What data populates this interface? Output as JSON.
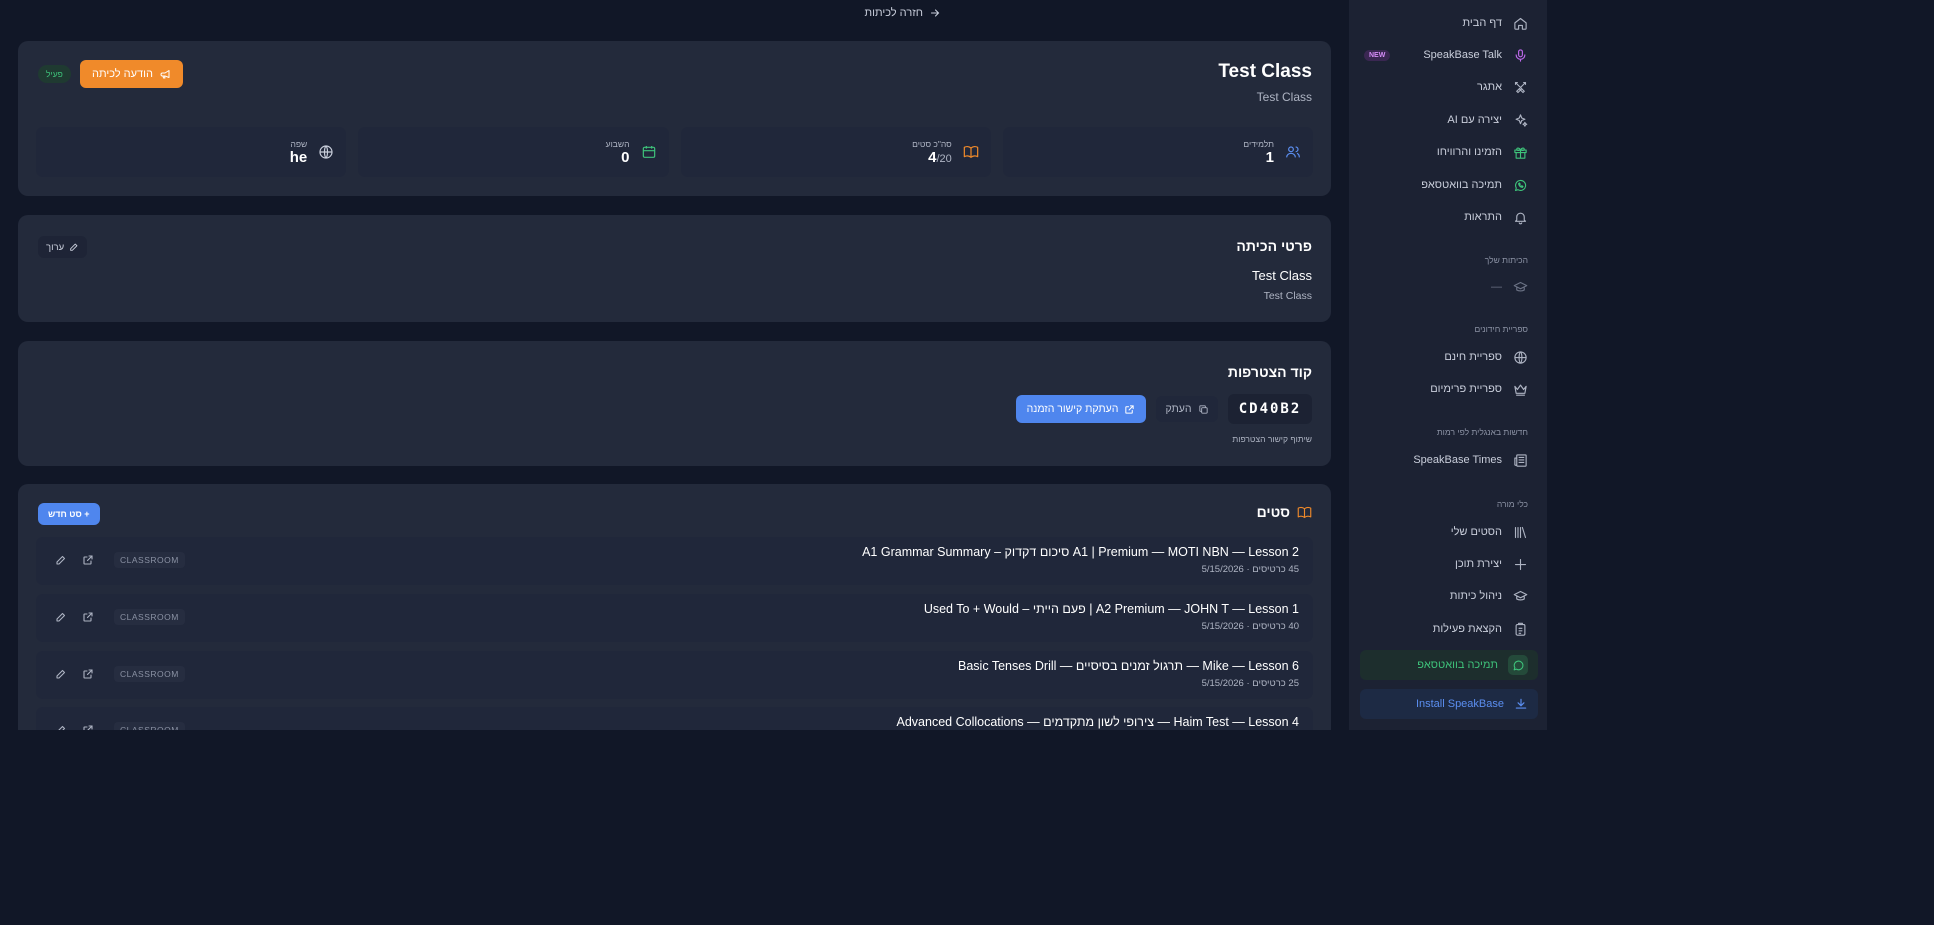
{
  "back_link": "חזרה לכיתות",
  "sidebar": {
    "items": [
      {
        "label": "דף הבית",
        "icon": "home-icon"
      },
      {
        "label": "SpeakBase Talk",
        "icon": "microphone-icon",
        "badge": "NEW"
      },
      {
        "label": "אתגר",
        "icon": "swords-icon"
      },
      {
        "label": "יצירה עם AI",
        "icon": "sparkles-icon"
      },
      {
        "label": "הזמינו והרוויחו",
        "icon": "gift-icon"
      },
      {
        "label": "תמיכה בוואטסאפ",
        "icon": "whatsapp-icon"
      },
      {
        "label": "התראות",
        "icon": "bell-icon"
      }
    ],
    "classes_section": "הכיתות שלך",
    "classes_placeholder": "—",
    "library_section": "ספריית חידונים",
    "library_items": [
      {
        "label": "ספריית חינם",
        "icon": "globe-icon"
      },
      {
        "label": "ספריית פרימיום",
        "icon": "crown-icon"
      }
    ],
    "news_section": "חדשות באנגלית לפי רמות",
    "news_items": [
      {
        "label": "SpeakBase Times",
        "icon": "newspaper-icon"
      }
    ],
    "teacher_section": "כלי מורה",
    "teacher_items": [
      {
        "label": "הסטים שלי",
        "icon": "library-icon"
      },
      {
        "label": "יצירת תוכן",
        "icon": "plus-icon"
      },
      {
        "label": "ניהול כיתות",
        "icon": "graduation-cap-icon"
      },
      {
        "label": "הקצאת פעילות",
        "icon": "clipboard-icon"
      }
    ],
    "whatsapp_active": "תמיכה בוואטסאפ",
    "install": "Install SpeakBase"
  },
  "class_header": {
    "title": "Test Class",
    "subtitle": "Test Class",
    "status": "פעיל",
    "announce_button": "הודעה לכיתה",
    "stats": [
      {
        "label": "תלמידים",
        "value": "1",
        "suffix": "",
        "icon": "users-icon",
        "color": "#5b8ef0"
      },
      {
        "label": "סה\"כ סטים",
        "value": "4",
        "suffix": "/20",
        "icon": "book-icon",
        "color": "#f08a2a"
      },
      {
        "label": "השבוע",
        "value": "0",
        "suffix": "",
        "icon": "calendar-icon",
        "color": "#3ec27a"
      },
      {
        "label": "שפה",
        "value": "he",
        "suffix": "",
        "icon": "globe-icon",
        "color": "#c9cedb"
      }
    ]
  },
  "details": {
    "title": "פרטי הכיתה",
    "name": "Test Class",
    "description": "Test Class",
    "edit_button": "ערוך"
  },
  "join": {
    "title": "קוד הצטרפות",
    "code": "CD40B2",
    "copy_button": "העתק",
    "invite_button": "העתקת קישור הזמנה",
    "caption": "שיתוף קישור הצטרפות"
  },
  "sets": {
    "title": "סטים",
    "new_button": "+ סט חדש",
    "rows": [
      {
        "title": "A1 | Premium — MOTI NBN — Lesson 2 סיכום דקדוק – A1 Grammar Summary",
        "meta": "45 כרטיסים · 5/15/2026",
        "tag": "CLASSROOM"
      },
      {
        "title": "A2 Premium — JOHN T — Lesson 1 | פעם הייתי – Used To + Would",
        "meta": "40 כרטיסים · 5/15/2026",
        "tag": "CLASSROOM"
      },
      {
        "title": "Mike — Lesson 6 — תרגול זמנים בסיסיים — Basic Tenses Drill",
        "meta": "25 כרטיסים · 5/15/2026",
        "tag": "CLASSROOM"
      },
      {
        "title": "Haim Test — Lesson 4 — צירופי לשון מתקדמים — Advanced Collocations",
        "meta": "",
        "tag": "CLASSROOM"
      }
    ]
  }
}
